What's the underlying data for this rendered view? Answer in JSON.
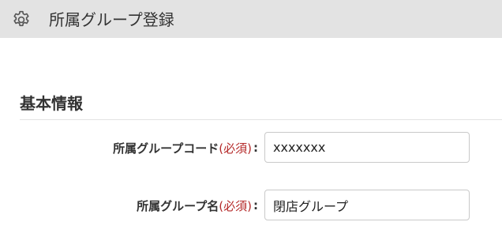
{
  "header": {
    "icon": "gear-icon",
    "title": "所属グループ登録"
  },
  "section": {
    "title": "基本情報"
  },
  "form": {
    "fields": [
      {
        "label": "所属グループコード",
        "required_text": "(必須)",
        "colon": ":",
        "value": "xxxxxxx"
      },
      {
        "label": "所属グループ名",
        "required_text": "(必須)",
        "colon": ":",
        "value": "閉店グループ"
      }
    ]
  },
  "colors": {
    "header_bg": "#e3e3e3",
    "required": "#b52a2a",
    "text": "#333333",
    "input_border": "#c9c9c9"
  }
}
